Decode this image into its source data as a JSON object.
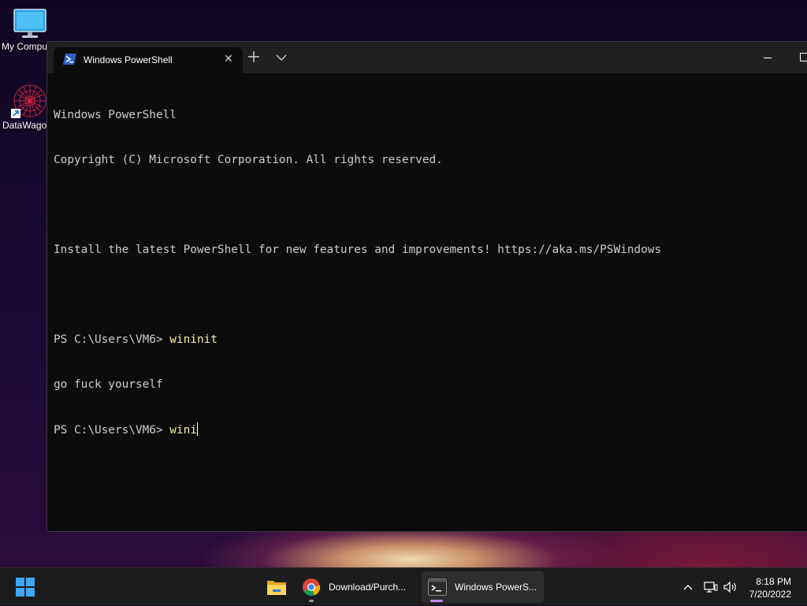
{
  "desktop": {
    "icons": [
      {
        "label": "My Compu",
        "icon": "computer-icon"
      },
      {
        "label": "DataWagon",
        "icon": "datawagon-app-icon"
      }
    ]
  },
  "window": {
    "tab_title": "Windows PowerShell",
    "tab_icon": "powershell-icon",
    "new_tab_icon": "plus-icon",
    "dropdown_icon": "chevron-down-icon",
    "close_icon": "close-icon"
  },
  "terminal": {
    "lines": [
      "Windows PowerShell",
      "Copyright (C) Microsoft Corporation. All rights reserved.",
      "",
      "Install the latest PowerShell for new features and improvements! https://aka.ms/PSWindows",
      ""
    ],
    "prompt1": "PS C:\\Users\\VM6> ",
    "cmd1": "wininit",
    "output1": "go fuck yourself",
    "prompt2": "PS C:\\Users\\VM6> ",
    "cmd2": "wini"
  },
  "taskbar": {
    "start_icon": "windows-start-icon",
    "apps": [
      {
        "label": "",
        "icon": "file-explorer-icon"
      },
      {
        "label": "Download/Purch...",
        "icon": "chrome-icon"
      },
      {
        "label": "Windows PowerS...",
        "icon": "terminal-icon"
      }
    ],
    "clock_time": "8:18 PM",
    "clock_date": "7/20/2022"
  },
  "colors": {
    "terminal_bg": "#0c0c0c",
    "terminal_text": "#cccccc",
    "command_text": "#f9f1a5",
    "accent": "#c586ff"
  }
}
